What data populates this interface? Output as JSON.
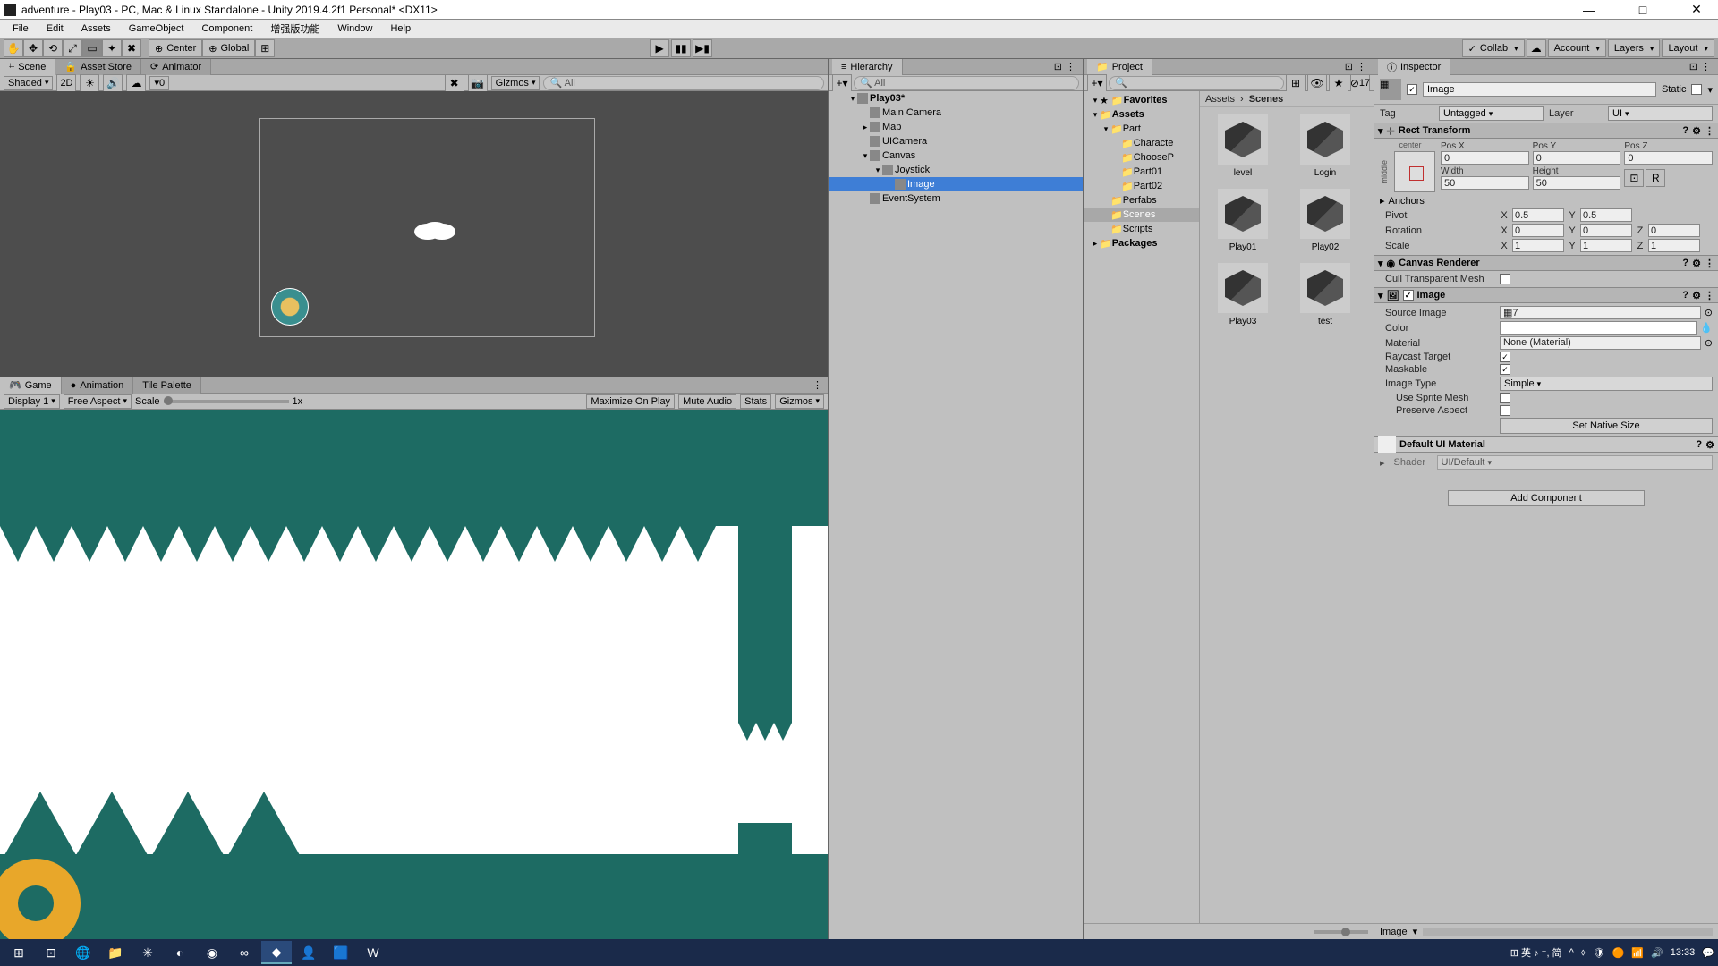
{
  "window": {
    "title": "adventure - Play03 - PC, Mac & Linux Standalone - Unity 2019.4.2f1 Personal* <DX11>"
  },
  "menubar": [
    "File",
    "Edit",
    "Assets",
    "GameObject",
    "Component",
    "增强版功能",
    "Window",
    "Help"
  ],
  "toolbar": {
    "pivot_center": "Center",
    "pivot_global": "Global",
    "collab": "Collab",
    "account": "Account",
    "layers": "Layers",
    "layout": "Layout"
  },
  "scene_panel": {
    "tabs": [
      "Scene",
      "Asset Store",
      "Animator"
    ],
    "shading": "Shaded",
    "btn_2d": "2D",
    "gizmos": "Gizmos",
    "search_placeholder": "All"
  },
  "game_panel": {
    "tabs": [
      "Game",
      "Animation",
      "Tile Palette"
    ],
    "display": "Display 1",
    "aspect": "Free Aspect",
    "scale_label": "Scale",
    "scale_value": "1x",
    "maximize": "Maximize On Play",
    "mute": "Mute Audio",
    "stats": "Stats",
    "gizmos": "Gizmos"
  },
  "hierarchy": {
    "title": "Hierarchy",
    "search_placeholder": "All",
    "items": [
      {
        "indent": 0,
        "foldout": "▾",
        "name": "Play03*",
        "bold": true
      },
      {
        "indent": 1,
        "foldout": "",
        "name": "Main Camera"
      },
      {
        "indent": 1,
        "foldout": "▸",
        "name": "Map"
      },
      {
        "indent": 1,
        "foldout": "",
        "name": "UICamera"
      },
      {
        "indent": 1,
        "foldout": "▾",
        "name": "Canvas"
      },
      {
        "indent": 2,
        "foldout": "▾",
        "name": "Joystick"
      },
      {
        "indent": 3,
        "foldout": "",
        "name": "Image",
        "selected": true
      },
      {
        "indent": 1,
        "foldout": "",
        "name": "EventSystem"
      }
    ]
  },
  "project": {
    "title": "Project",
    "count": "17",
    "breadcrumb": [
      "Assets",
      "Scenes"
    ],
    "tree": [
      {
        "indent": 0,
        "foldout": "▾",
        "name": "Favorites",
        "star": true
      },
      {
        "indent": 0,
        "foldout": "▾",
        "name": "Assets"
      },
      {
        "indent": 1,
        "foldout": "▾",
        "name": "Part"
      },
      {
        "indent": 2,
        "foldout": "",
        "name": "Characte"
      },
      {
        "indent": 2,
        "foldout": "",
        "name": "ChooseP"
      },
      {
        "indent": 2,
        "foldout": "",
        "name": "Part01"
      },
      {
        "indent": 2,
        "foldout": "",
        "name": "Part02"
      },
      {
        "indent": 1,
        "foldout": "",
        "name": "Perfabs"
      },
      {
        "indent": 1,
        "foldout": "",
        "name": "Scenes",
        "selected": true
      },
      {
        "indent": 1,
        "foldout": "",
        "name": "Scripts"
      },
      {
        "indent": 0,
        "foldout": "▸",
        "name": "Packages"
      }
    ],
    "grid": [
      "level",
      "Login",
      "Play01",
      "Play02",
      "Play03",
      "test"
    ],
    "footer": "Image"
  },
  "inspector": {
    "title": "Inspector",
    "object_name": "Image",
    "static_label": "Static",
    "tag_label": "Tag",
    "tag_value": "Untagged",
    "layer_label": "Layer",
    "layer_value": "UI",
    "rect_transform": {
      "title": "Rect Transform",
      "anchor_label_h": "center",
      "anchor_label_v": "middle",
      "pos_x_label": "Pos X",
      "pos_x": "0",
      "pos_y_label": "Pos Y",
      "pos_y": "0",
      "pos_z_label": "Pos Z",
      "pos_z": "0",
      "width_label": "Width",
      "width": "50",
      "height_label": "Height",
      "height": "50",
      "anchors_label": "Anchors",
      "pivot_label": "Pivot",
      "pivot_x": "0.5",
      "pivot_y": "0.5",
      "rotation_label": "Rotation",
      "rot_x": "0",
      "rot_y": "0",
      "rot_z": "0",
      "scale_label": "Scale",
      "scale_x": "1",
      "scale_y": "1",
      "scale_z": "1"
    },
    "canvas_renderer": {
      "title": "Canvas Renderer",
      "cull_label": "Cull Transparent Mesh"
    },
    "image_comp": {
      "title": "Image",
      "source_label": "Source Image",
      "source_value": "7",
      "color_label": "Color",
      "material_label": "Material",
      "material_value": "None (Material)",
      "raycast_label": "Raycast Target",
      "maskable_label": "Maskable",
      "image_type_label": "Image Type",
      "image_type_value": "Simple",
      "use_sprite_label": "Use Sprite Mesh",
      "preserve_label": "Preserve Aspect",
      "set_native_btn": "Set Native Size"
    },
    "material": {
      "title": "Default UI Material",
      "shader_label": "Shader",
      "shader_value": "UI/Default"
    },
    "add_component": "Add Component"
  },
  "taskbar": {
    "ime": "英 ♪ ⁺, 简",
    "time": "13:33"
  }
}
